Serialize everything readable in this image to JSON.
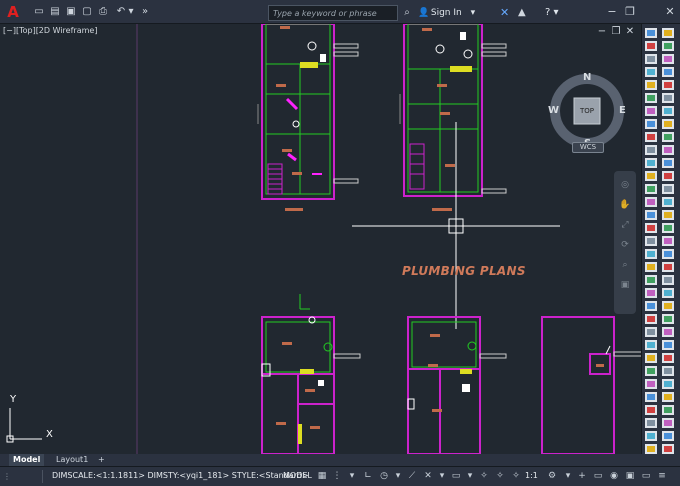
{
  "titlebar": {
    "search_placeholder": "Type a keyword or phrase",
    "signin_label": "Sign In",
    "quick_access": [
      "file-new-icon",
      "open-icon",
      "save-icon",
      "saveas-icon",
      "print-icon",
      "undo-icon",
      "more-icon"
    ]
  },
  "viewport": {
    "label": "[−][Top][2D Wireframe]",
    "plan_title": "PLUMBING PLANS",
    "compass": {
      "n": "N",
      "s": "S",
      "e": "E",
      "w": "W",
      "cube": "TOP"
    },
    "wcs_label": "WCS",
    "ucs": {
      "x": "X",
      "y": "Y"
    }
  },
  "tabs": {
    "model": "Model",
    "layout1": "Layout1",
    "add": "+"
  },
  "status": {
    "text": "DIMSCALE:<1:1.1811> DIMSTY:<yqi1_181> STYLE:<Standard>",
    "model": "MODEL",
    "scale": "1:1"
  },
  "colors": {
    "background": "#212830",
    "chrome": "#2b3240",
    "plan_title": "#d07a5a",
    "wall_magenta": "#cc22cc",
    "wall_green": "#22cc22"
  }
}
